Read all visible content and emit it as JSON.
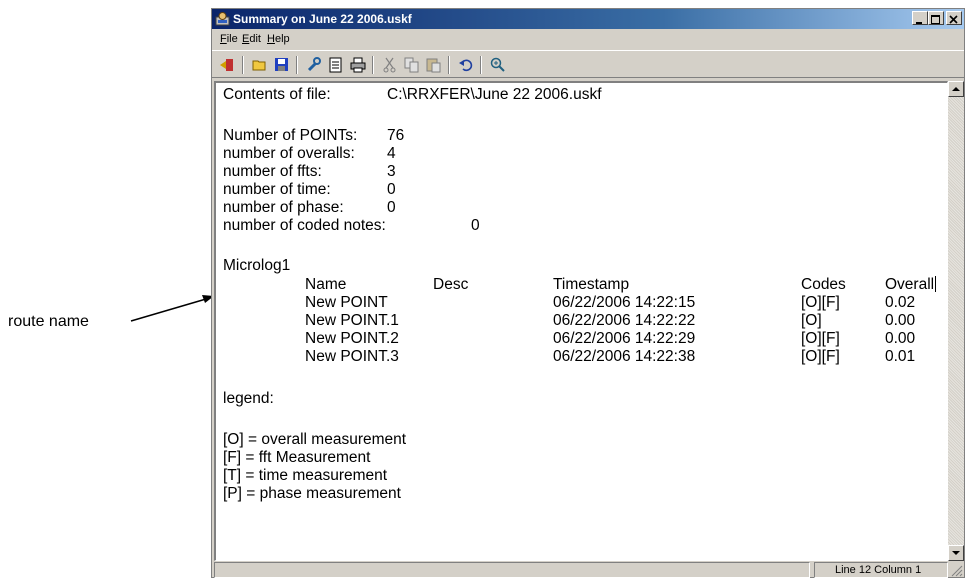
{
  "window": {
    "title": "Summary on June 22 2006.uskf",
    "menu": [
      {
        "key": "F",
        "rest": "ile"
      },
      {
        "key": "E",
        "rest": "dit"
      },
      {
        "key": "H",
        "rest": "elp"
      }
    ],
    "toolbar_icons": [
      "exit-icon",
      "open-folder-icon",
      "save-icon",
      "tools-icon",
      "document-icon",
      "print-icon",
      "cut-icon",
      "copy-icon",
      "paste-icon",
      "undo-icon",
      "zoom-in-icon"
    ]
  },
  "content": {
    "contents_label": "Contents of file:",
    "contents_value": "C:\\RRXFER\\June 22 2006.uskf",
    "stats": [
      {
        "label": "Number of POINTs:",
        "value": "76"
      },
      {
        "label": "number of overalls:",
        "value": "4"
      },
      {
        "label": "number of ffts:",
        "value": "3"
      },
      {
        "label": "number of time:",
        "value": "0"
      },
      {
        "label": "number of phase:",
        "value": "0"
      },
      {
        "label": "number of coded notes:",
        "value": "0"
      }
    ],
    "route_name": "Microlog1",
    "columns": {
      "name": "Name",
      "desc": "Desc",
      "timestamp": "Timestamp",
      "codes": "Codes",
      "overall": "Overall"
    },
    "rows": [
      {
        "name": "New POINT",
        "timestamp": "06/22/2006 14:22:15",
        "codes": "[O][F]",
        "overall": "0.02"
      },
      {
        "name": "New POINT.1",
        "timestamp": "06/22/2006 14:22:22",
        "codes": "[O]",
        "overall": "0.00"
      },
      {
        "name": "New POINT.2",
        "timestamp": "06/22/2006 14:22:29",
        "codes": "[O][F]",
        "overall": "0.00"
      },
      {
        "name": "New POINT.3",
        "timestamp": "06/22/2006 14:22:38",
        "codes": "[O][F]",
        "overall": "0.01"
      }
    ],
    "legend_title": "legend:",
    "legend": [
      "[O] = overall measurement",
      "[F] = fft Measurement",
      "[T] = time measurement",
      "[P] = phase measurement"
    ]
  },
  "status": {
    "position": "Line 12 Column 1"
  },
  "annotation": {
    "label": "route name"
  }
}
